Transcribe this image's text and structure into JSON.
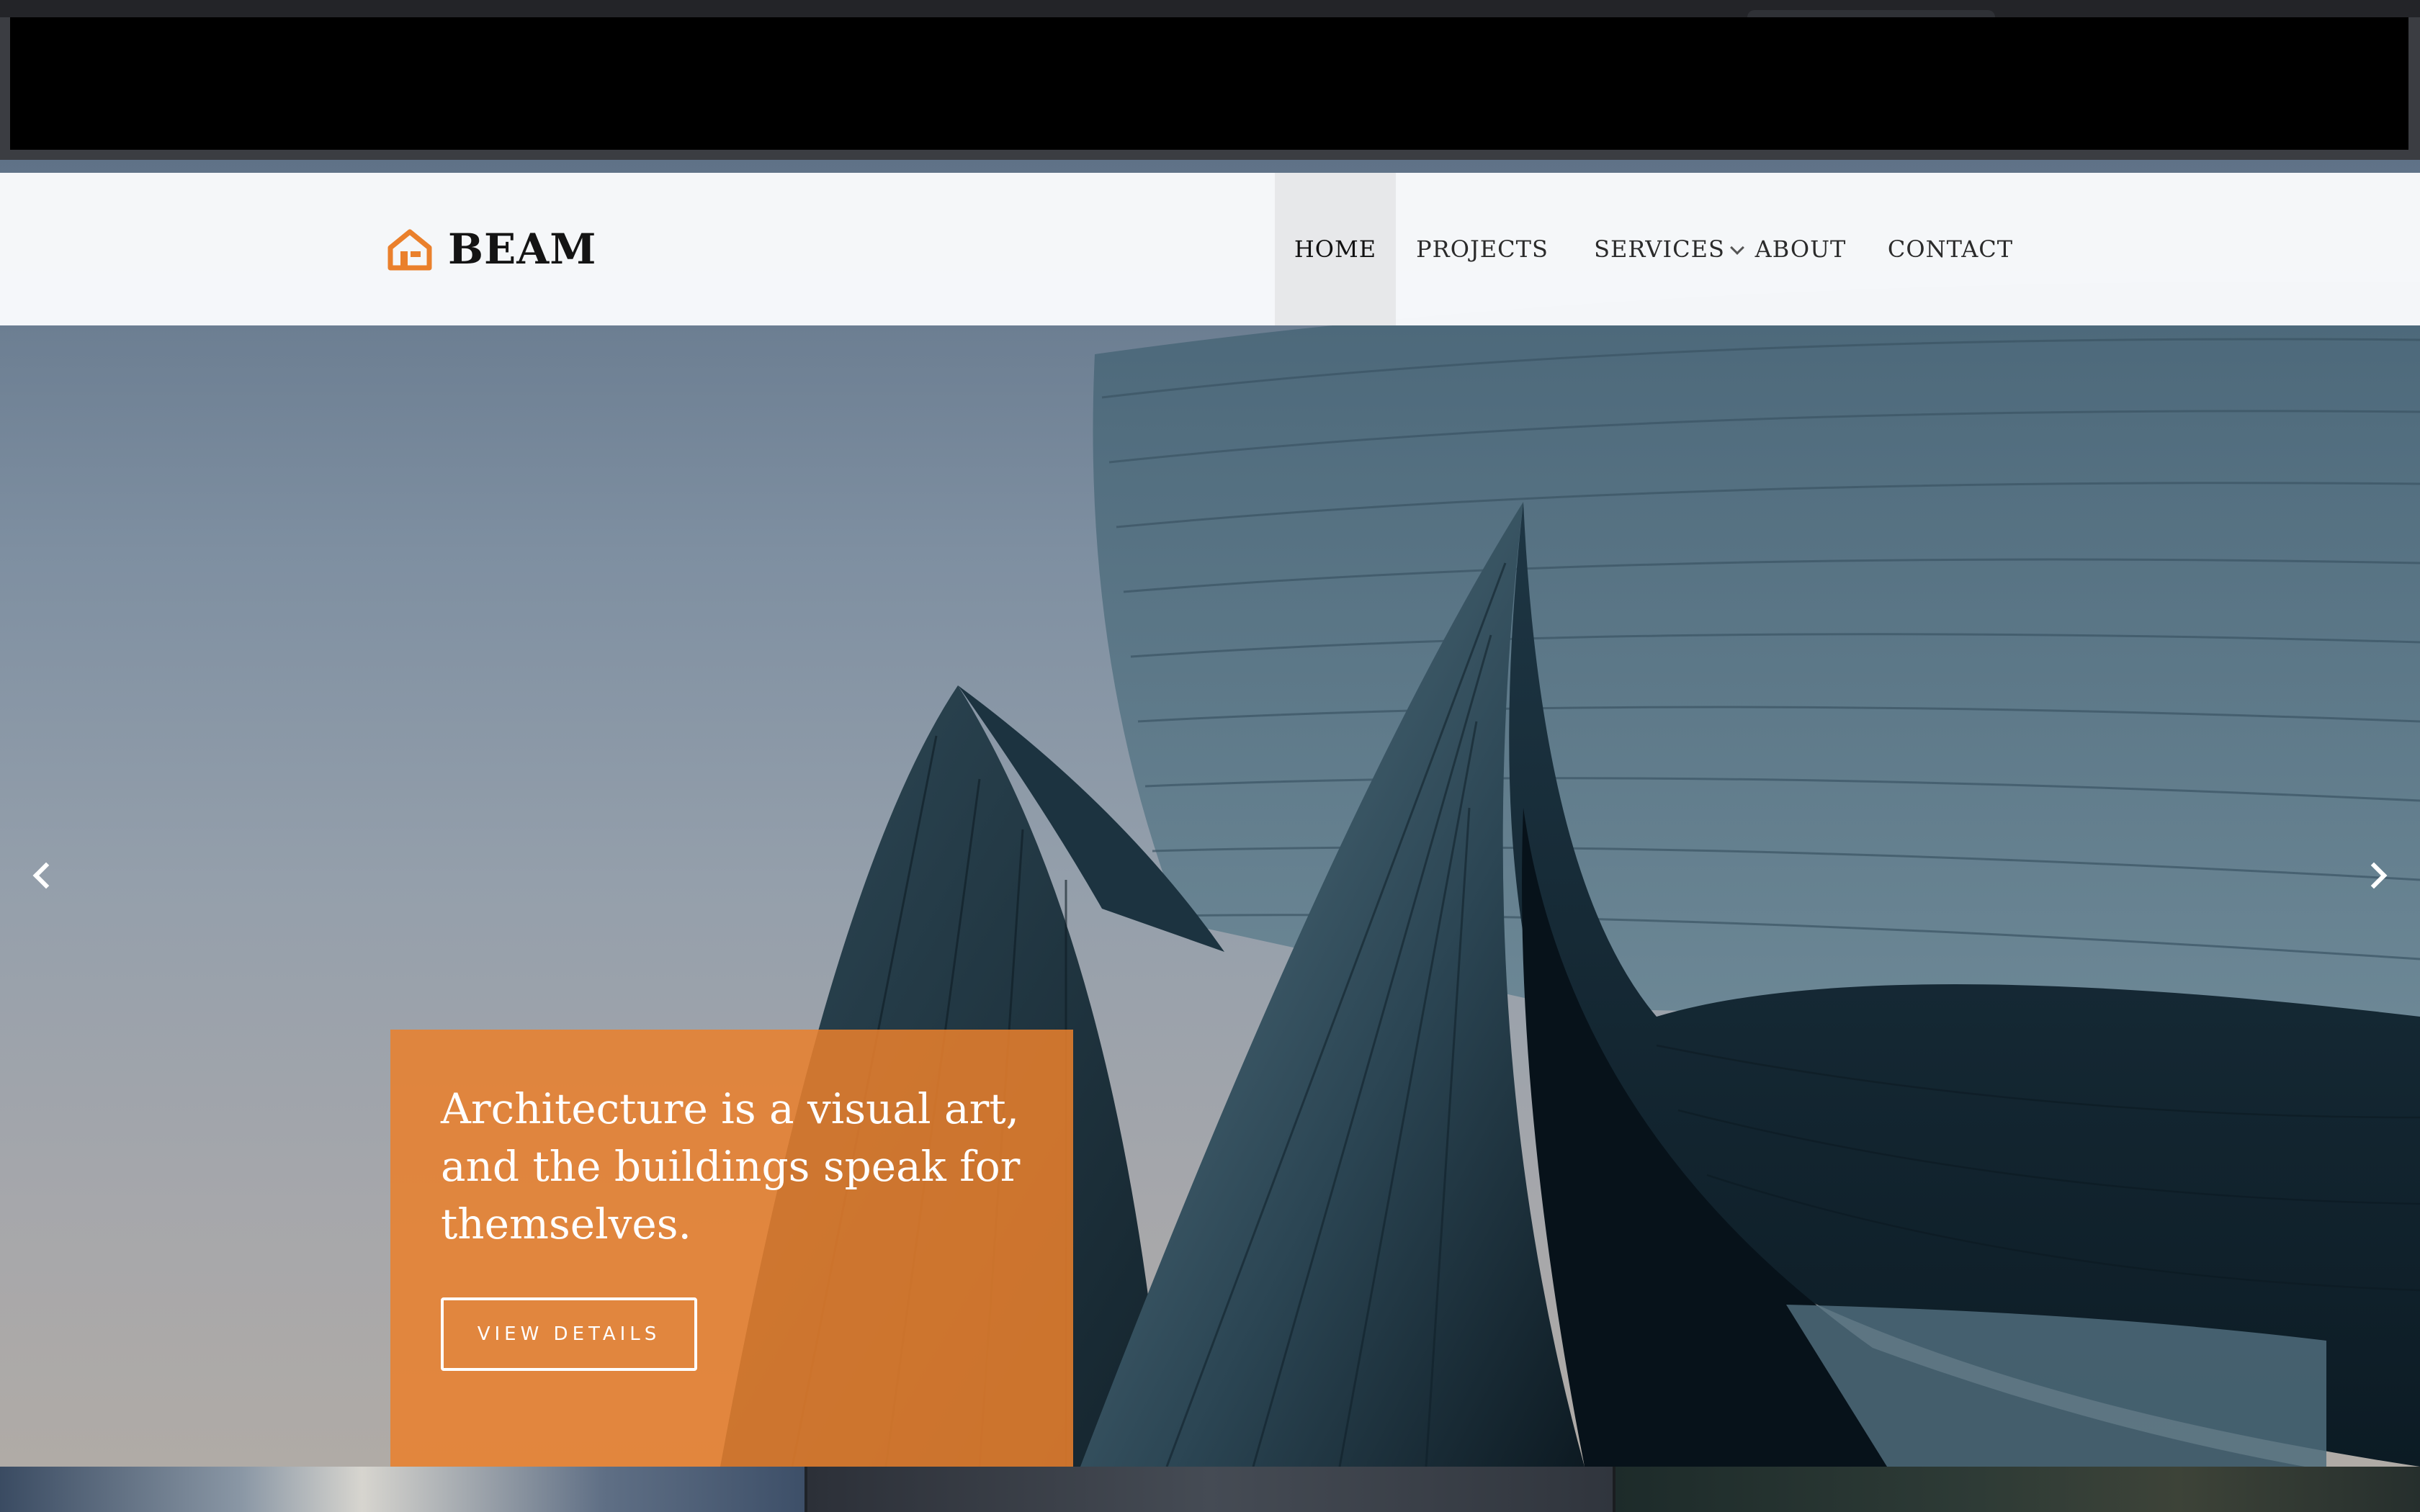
{
  "brand": {
    "name": "BEAM",
    "logo_icon": "house-icon",
    "accent": "#ea802c"
  },
  "nav": {
    "items": [
      {
        "label": "HOME",
        "active": true
      },
      {
        "label": "PROJECTS",
        "active": false
      },
      {
        "label": "SERVICES",
        "active": false,
        "has_dropdown": true
      },
      {
        "label": "ABOUT",
        "active": false
      },
      {
        "label": "CONTACT",
        "active": false
      }
    ]
  },
  "slider": {
    "prev_icon": "chevron-left-icon",
    "next_icon": "chevron-right-icon",
    "caption": {
      "text": "Architecture is a visual art, and the buildings speak for themselves.",
      "button_label": "VIEW DETAILS",
      "background": "#ea802c"
    }
  }
}
